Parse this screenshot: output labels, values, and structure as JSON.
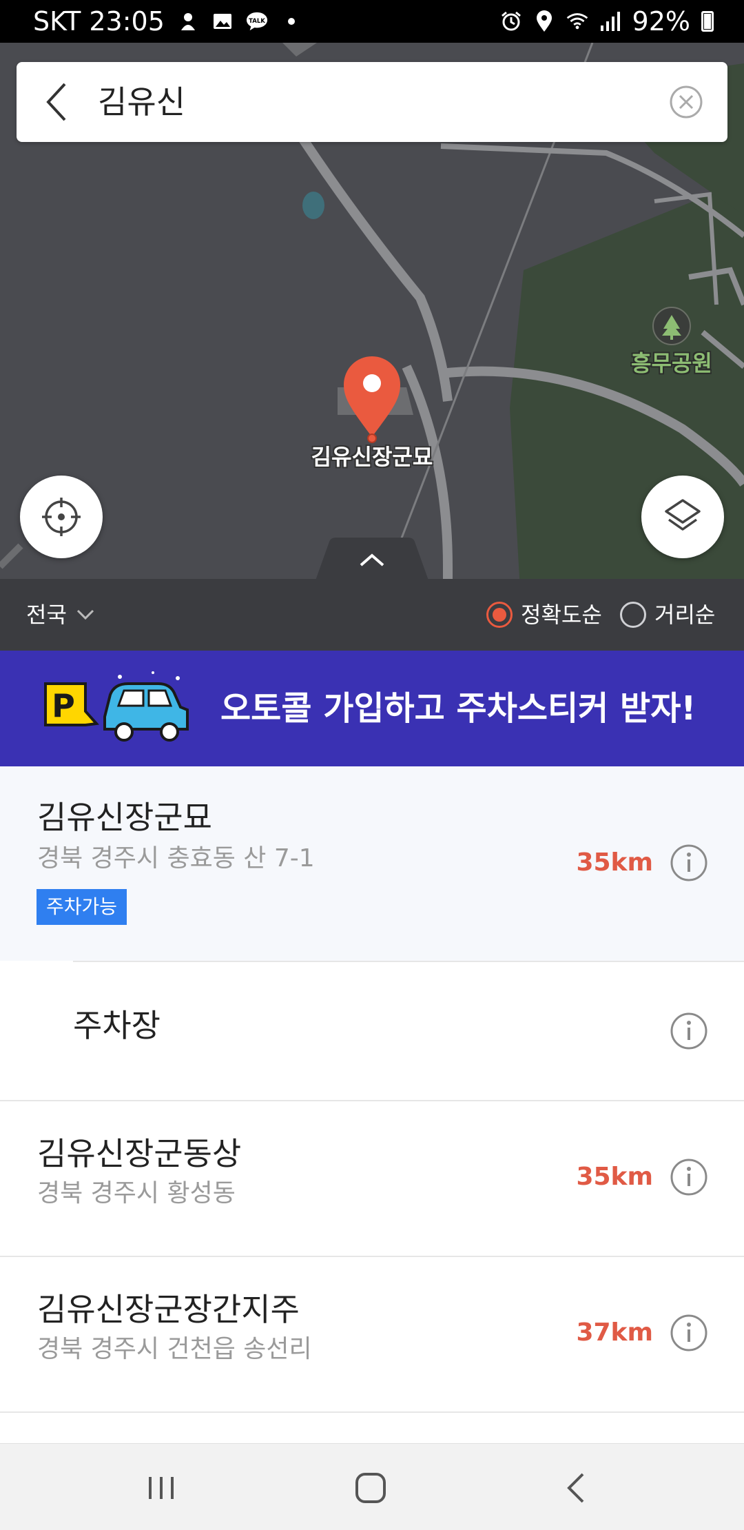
{
  "status_bar": {
    "carrier_time": "SKT 23:05",
    "battery": "92%",
    "icons": [
      "emoji-icon",
      "gallery-icon",
      "talk-icon",
      "dot-icon",
      "alarm-icon",
      "location-icon",
      "wifi-icon",
      "signal-icon",
      "battery-icon"
    ]
  },
  "search": {
    "query": "김유신",
    "back_icon": "chevron-left-icon",
    "clear_icon": "circle-x-icon"
  },
  "map": {
    "pin_label": "김유신장군묘",
    "park_label": "흥무공원",
    "pin_color": "#ea5a3f"
  },
  "filter": {
    "region": "전국",
    "sort_accuracy": "정확도순",
    "sort_distance": "거리순",
    "selected": "정확도순"
  },
  "banner": {
    "text": "오토콜 가입하고 주차스티커 받자!",
    "bg_color": "#3a31b3"
  },
  "results": [
    {
      "name": "김유신장군묘",
      "address": "경북 경주시 충효동 산 7-1",
      "badge": "주차가능",
      "distance": "35km"
    },
    {
      "name": "주차장"
    },
    {
      "name": "김유신장군동상",
      "address": "경북 경주시 황성동",
      "distance": "35km"
    },
    {
      "name": "김유신장군장간지주",
      "address": "경북 경주시 건천읍 송선리",
      "distance": "37km"
    }
  ],
  "accent_color": "#e05a45"
}
